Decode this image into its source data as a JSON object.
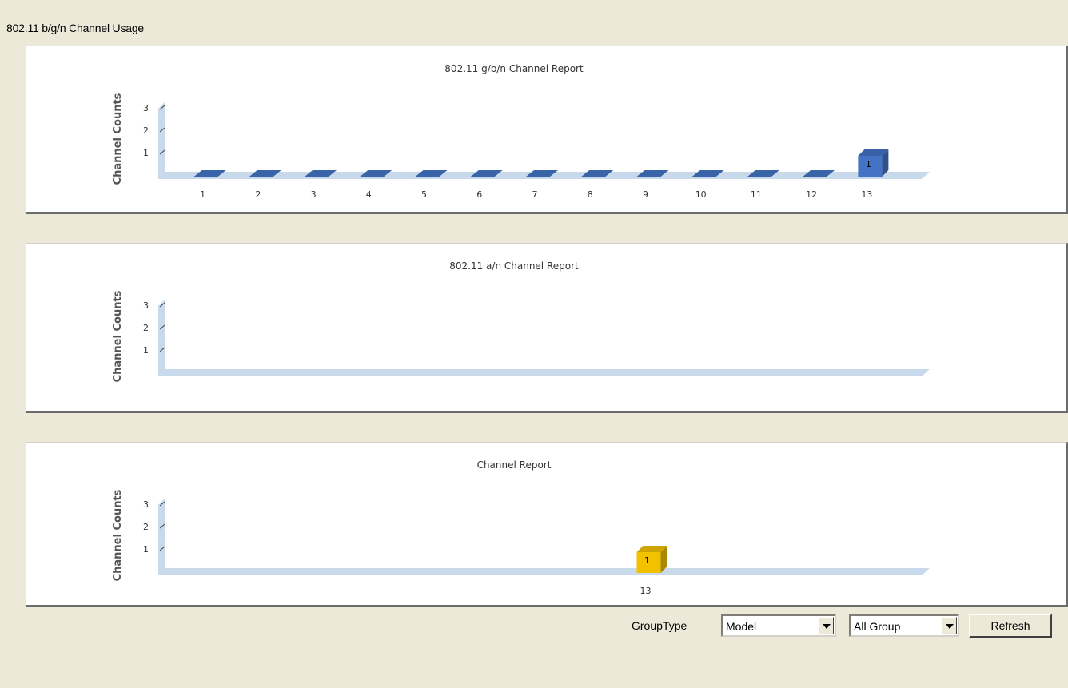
{
  "page_title": "802.11 b/g/n Channel Usage",
  "charts": [
    {
      "title": "802.11 g/b/n Channel Report",
      "ylabel": "Channel Counts",
      "yticks": [
        "1",
        "2",
        "3"
      ],
      "bar_color": "#4472c4",
      "flat_color": "#3a64a8"
    },
    {
      "title": "802.11 a/n Channel Report",
      "ylabel": "Channel Counts",
      "yticks": [
        "1",
        "2",
        "3"
      ],
      "bar_color": "#4472c4",
      "flat_color": "#3a64a8"
    },
    {
      "title": "Channel Report",
      "ylabel": "Channel Counts",
      "yticks": [
        "1",
        "2",
        "3"
      ],
      "bar_color": "#f2c200",
      "flat_color": "#d9a600"
    }
  ],
  "chart_data": [
    {
      "type": "bar",
      "title": "802.11 g/b/n Channel Report",
      "xlabel": "",
      "ylabel": "Channel Counts",
      "categories": [
        "1",
        "2",
        "3",
        "4",
        "5",
        "6",
        "7",
        "8",
        "9",
        "10",
        "11",
        "12",
        "13"
      ],
      "values": [
        0,
        0,
        0,
        0,
        0,
        0,
        0,
        0,
        0,
        0,
        0,
        0,
        1
      ],
      "data_labels": [
        "",
        "",
        "",
        "",
        "",
        "",
        "",
        "",
        "",
        "",
        "",
        "",
        "1"
      ],
      "ylim": [
        0,
        3
      ]
    },
    {
      "type": "bar",
      "title": "802.11 a/n Channel Report",
      "xlabel": "",
      "ylabel": "Channel Counts",
      "categories": [],
      "values": [],
      "data_labels": [],
      "ylim": [
        0,
        3
      ]
    },
    {
      "type": "bar",
      "title": "Channel Report",
      "xlabel": "",
      "ylabel": "Channel Counts",
      "categories": [
        "13"
      ],
      "values": [
        1
      ],
      "data_labels": [
        "1"
      ],
      "ylim": [
        0,
        3
      ]
    }
  ],
  "controls": {
    "grouptype_label": "GroupType",
    "grouptype_value": "Model",
    "group_value": "All Group",
    "refresh_label": "Refresh"
  }
}
